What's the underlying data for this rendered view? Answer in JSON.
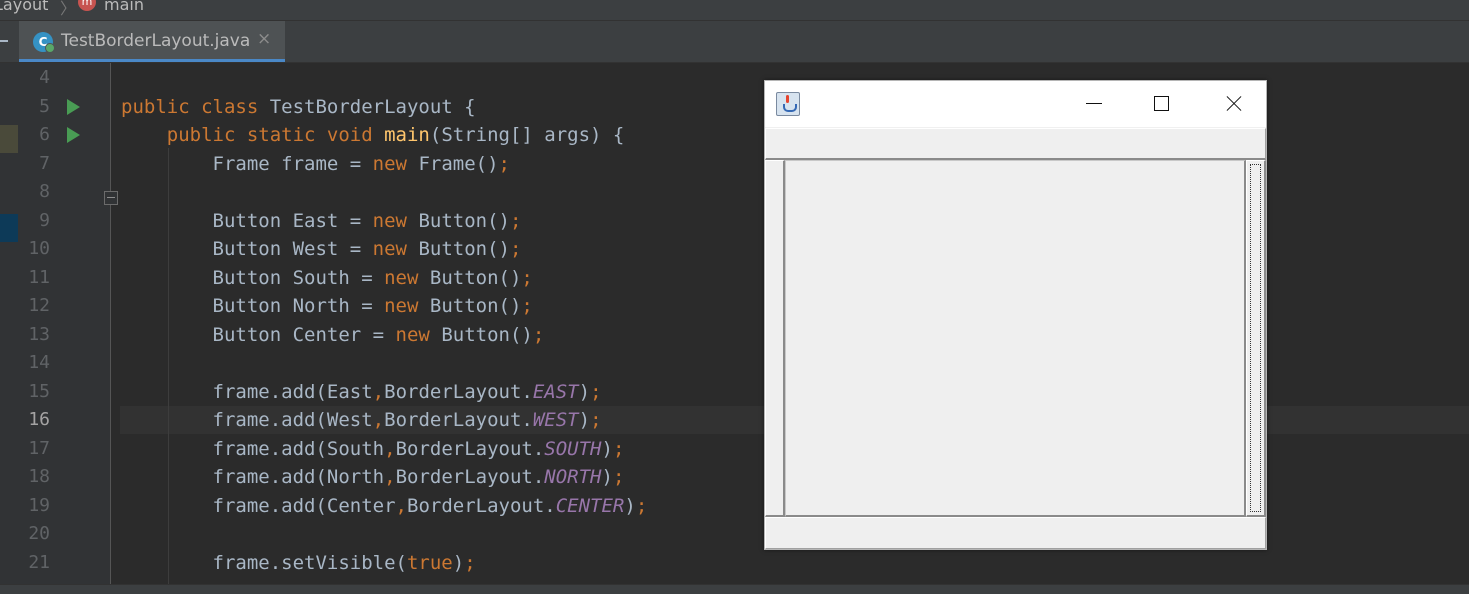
{
  "breadcrumb": {
    "items": [
      "Layout",
      "main"
    ],
    "method_icon": "m"
  },
  "tab": {
    "file_icon": "C",
    "label": "TestBorderLayout.java",
    "close_symbol": "×"
  },
  "editor": {
    "current_line": "16",
    "lines": [
      {
        "n": "4"
      },
      {
        "n": "5",
        "run": true,
        "parts": [
          [
            "kw",
            "public class "
          ],
          [
            "",
            "TestBorderLayout {"
          ]
        ]
      },
      {
        "n": "6",
        "run": true,
        "parts": [
          [
            "",
            "    "
          ],
          [
            "kw",
            "public static void "
          ],
          [
            "fn",
            "main"
          ],
          [
            "",
            "(String[] args) {"
          ]
        ]
      },
      {
        "n": "7",
        "parts": [
          [
            "",
            "        Frame frame = "
          ],
          [
            "kw",
            "new "
          ],
          [
            "",
            "Frame()"
          ],
          [
            "tl",
            ";"
          ]
        ]
      },
      {
        "n": "8"
      },
      {
        "n": "9",
        "parts": [
          [
            "",
            "        Button East = "
          ],
          [
            "kw",
            "new "
          ],
          [
            "",
            "Button()"
          ],
          [
            "tl",
            ";"
          ]
        ]
      },
      {
        "n": "10",
        "parts": [
          [
            "",
            "        Button West = "
          ],
          [
            "kw",
            "new "
          ],
          [
            "",
            "Button()"
          ],
          [
            "tl",
            ";"
          ]
        ]
      },
      {
        "n": "11",
        "parts": [
          [
            "",
            "        Button South = "
          ],
          [
            "kw",
            "new "
          ],
          [
            "",
            "Button()"
          ],
          [
            "tl",
            ";"
          ]
        ]
      },
      {
        "n": "12",
        "parts": [
          [
            "",
            "        Button North = "
          ],
          [
            "kw",
            "new "
          ],
          [
            "",
            "Button()"
          ],
          [
            "tl",
            ";"
          ]
        ]
      },
      {
        "n": "13",
        "parts": [
          [
            "",
            "        Button Center = "
          ],
          [
            "kw",
            "new "
          ],
          [
            "",
            "Button()"
          ],
          [
            "tl",
            ";"
          ]
        ]
      },
      {
        "n": "14"
      },
      {
        "n": "15",
        "parts": [
          [
            "",
            "        frame.add(East"
          ],
          [
            "tl",
            ","
          ],
          [
            "",
            "BorderLayout."
          ],
          [
            "cst",
            "EAST"
          ],
          [
            "",
            ")"
          ],
          [
            "tl",
            ";"
          ]
        ]
      },
      {
        "n": "16",
        "parts": [
          [
            "",
            "        frame.add(West"
          ],
          [
            "tl",
            ","
          ],
          [
            "",
            "BorderLayout."
          ],
          [
            "cst",
            "WEST"
          ],
          [
            "",
            ")"
          ],
          [
            "tl",
            ";"
          ]
        ]
      },
      {
        "n": "17",
        "parts": [
          [
            "",
            "        frame.add(South"
          ],
          [
            "tl",
            ","
          ],
          [
            "",
            "BorderLayout."
          ],
          [
            "cst",
            "SOUTH"
          ],
          [
            "",
            ")"
          ],
          [
            "tl",
            ";"
          ]
        ]
      },
      {
        "n": "18",
        "parts": [
          [
            "",
            "        frame.add(North"
          ],
          [
            "tl",
            ","
          ],
          [
            "",
            "BorderLayout."
          ],
          [
            "cst",
            "NORTH"
          ],
          [
            "",
            ")"
          ],
          [
            "tl",
            ";"
          ]
        ]
      },
      {
        "n": "19",
        "parts": [
          [
            "",
            "        frame.add(Center"
          ],
          [
            "tl",
            ","
          ],
          [
            "",
            "BorderLayout."
          ],
          [
            "cst",
            "CENTER"
          ],
          [
            "",
            ")"
          ],
          [
            "tl",
            ";"
          ]
        ]
      },
      {
        "n": "20"
      },
      {
        "n": "21",
        "parts": [
          [
            "",
            "        frame.setVisible("
          ],
          [
            "kw",
            "true"
          ],
          [
            "",
            ")"
          ],
          [
            "tl",
            ";"
          ]
        ]
      }
    ]
  },
  "awt_window": {
    "icon": "java-cup-icon",
    "title": "",
    "controls": [
      "minimize",
      "maximize",
      "close"
    ],
    "buttons": [
      "North",
      "West",
      "Center",
      "East",
      "South"
    ],
    "button_labels": [
      "",
      "",
      "",
      "",
      ""
    ],
    "focused_button": "East"
  },
  "colors": {
    "keyword": "#cc7832",
    "method": "#ffc66d",
    "constant": "#9876aa",
    "text": "#a9b7c6",
    "background": "#2b2b2b",
    "run_icon": "#499c54"
  }
}
